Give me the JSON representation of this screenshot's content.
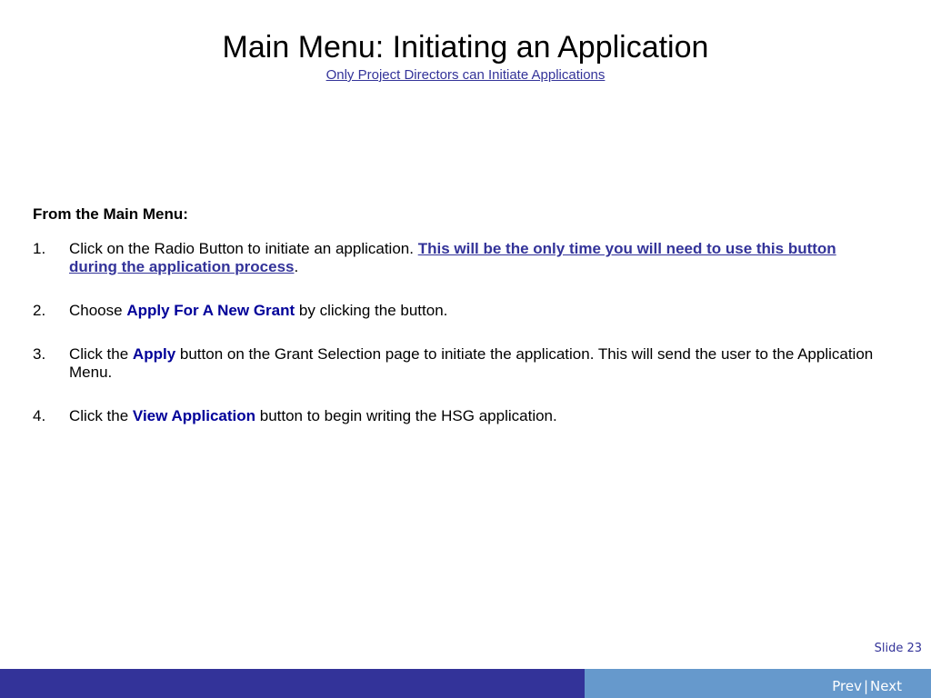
{
  "slide": {
    "title": "Main Menu: Initiating an Application",
    "subtitle": "Only Project Directors can Initiate Applications"
  },
  "content": {
    "intro": "From the Main Menu:",
    "steps": [
      {
        "num": "1.",
        "text_before": "Click on the Radio Button to initiate an application.",
        "emphasis": "This will be the only time you will need to use this button during the application process",
        "text_after": "."
      },
      {
        "num": "2.",
        "text_before": "Choose",
        "emphasis": "Apply For A New Grant",
        "text_after": "by clicking the button."
      },
      {
        "num": "3.",
        "text_before": "Click the",
        "emphasis": "Apply",
        "text_after": "button on the Grant Selection page to initiate the application.  This will send the user to the Application Menu."
      },
      {
        "num": "4.",
        "text_before": "Click the",
        "emphasis": "View Application",
        "text_after": "button to begin writing the HSG application."
      }
    ]
  },
  "footer": {
    "slide_number": "Slide 23",
    "prev_label": "Prev",
    "separator": "|",
    "next_label": "Next"
  },
  "colors": {
    "footer_dark": "#333399",
    "footer_light": "#6699cc",
    "emphasis_blue": "#000099",
    "link_blue": "#333399"
  }
}
